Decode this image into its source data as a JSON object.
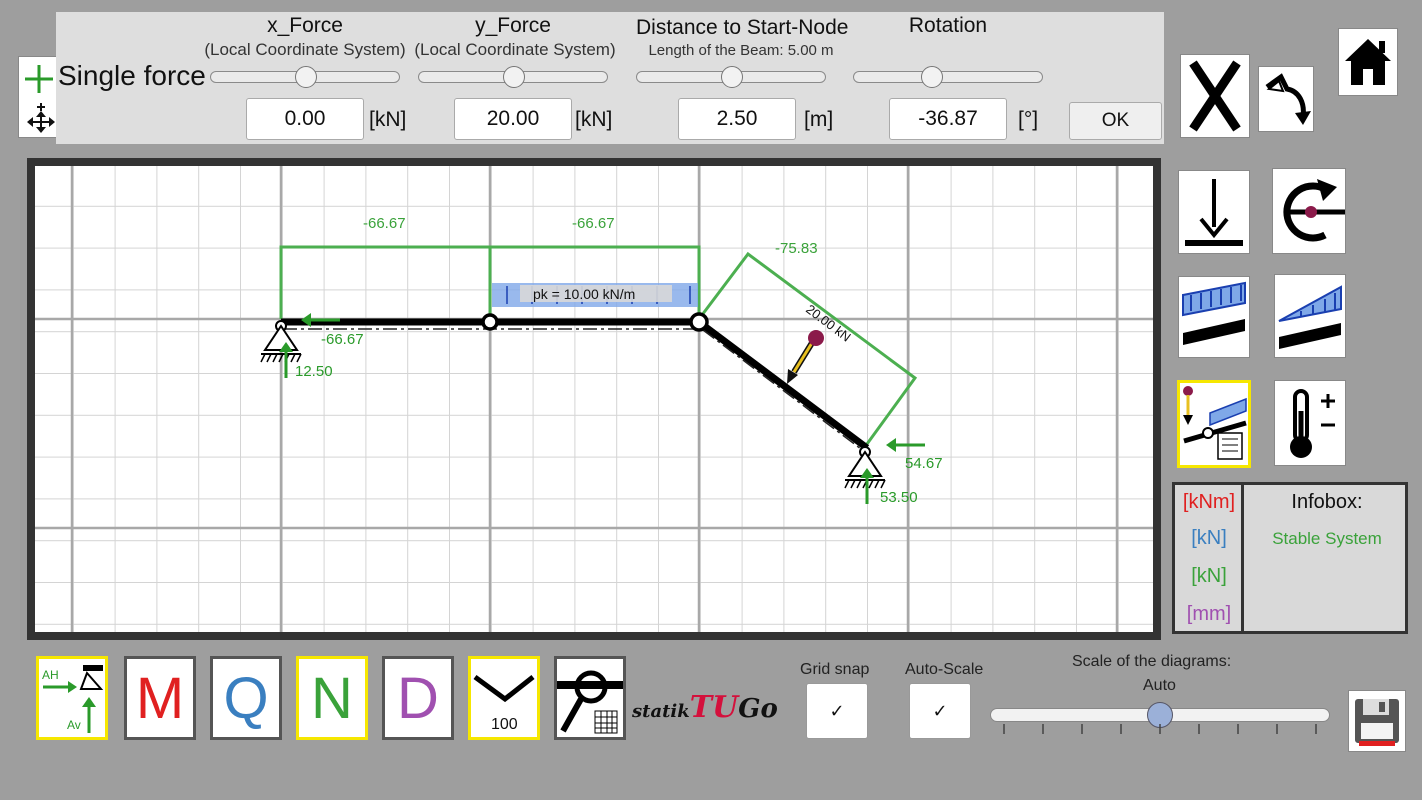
{
  "force_panel": {
    "title": "Single force",
    "x_force": {
      "title": "x_Force",
      "subtitle": "(Local Coordinate System)",
      "value": "0.00",
      "unit": "[kN]",
      "slider": 0.5
    },
    "y_force": {
      "title": "y_Force",
      "subtitle": "(Local Coordinate System)",
      "value": "20.00",
      "unit": "[kN]",
      "slider": 0.5
    },
    "distance": {
      "title": "Distance to Start-Node",
      "subtitle": "Length of the Beam: 5.00 m",
      "value": "2.50",
      "unit": "[m]",
      "slider": 0.5
    },
    "rotation": {
      "title": "Rotation",
      "value": "-36.87",
      "unit": "[°]",
      "slider": 0.4
    },
    "ok_label": "OK"
  },
  "canvas": {
    "normal_force_labels": [
      "-66.67",
      "-66.67",
      "-75.83"
    ],
    "load_label": "pk = 10.00 kN/m",
    "point_load_label": "20.00 kN",
    "reactions": [
      "-66.67",
      "12.50",
      "54.67",
      "53.50"
    ]
  },
  "right_toolbar": {
    "icons": [
      "close-icon",
      "undo-icon",
      "home-icon",
      "point-load-icon",
      "moment-icon",
      "uniform-load-icon",
      "triangular-load-icon",
      "single-force-beam-icon",
      "temperature-icon"
    ]
  },
  "infobox": {
    "title": "Infobox:",
    "status": "Stable System",
    "units": [
      "[kNm]",
      "[kN]",
      "[kN]",
      "[mm]"
    ],
    "colors": {
      "kNm": "#e02020",
      "kN_q": "#3a7fc0",
      "kN_n": "#3aa23a",
      "mm": "#a050b0",
      "diagram": "#4caf50"
    }
  },
  "bottom_toolbar": {
    "reaction_labels": {
      "h": "AH",
      "v": "Av"
    },
    "buttons": [
      "M",
      "Q",
      "N",
      "D"
    ],
    "deflection_value": "100",
    "logo": {
      "prefix": "statik",
      "brand": "TU",
      "suffix": "Go"
    },
    "grid_snap": {
      "label": "Grid snap",
      "checked": "✓"
    },
    "auto_scale": {
      "label": "Auto-Scale",
      "checked": "✓"
    },
    "scale": {
      "label": "Scale of the diagrams:",
      "value": "Auto",
      "slider": 0.49
    }
  }
}
